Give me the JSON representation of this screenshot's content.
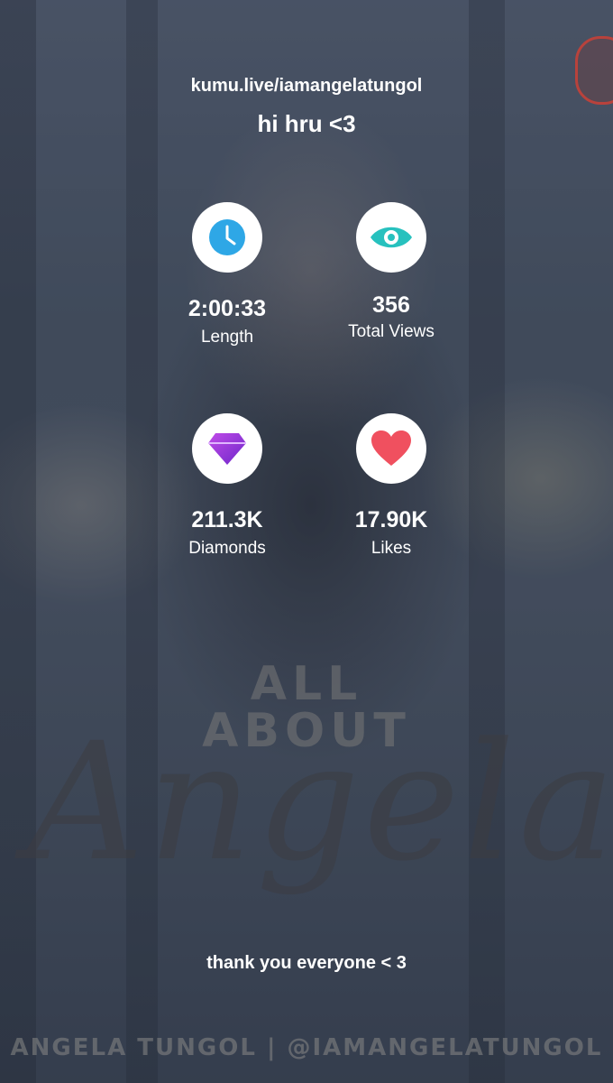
{
  "header": {
    "url": "kumu.live/iamangelatungol",
    "greeting": "hi hru <3"
  },
  "stats": [
    {
      "icon": "clock-icon",
      "value": "2:00:33",
      "label": "Length",
      "color": "#2ea7e6"
    },
    {
      "icon": "eye-icon",
      "value": "356",
      "label": "Total Views",
      "color": "#27c1be"
    },
    {
      "icon": "diamond-icon",
      "value": "211.3K",
      "label": "Diamonds",
      "color": "#9b38d8"
    },
    {
      "icon": "heart-icon",
      "value": "17.90K",
      "label": "Likes",
      "color": "#f0505f"
    }
  ],
  "overlay_title": {
    "line1": "ALL",
    "line2": "ABOUT",
    "script": "Angela"
  },
  "message": "thank you everyone < 3",
  "footer": "ANGELA TUNGOL | @IAMANGELATUNGOL"
}
